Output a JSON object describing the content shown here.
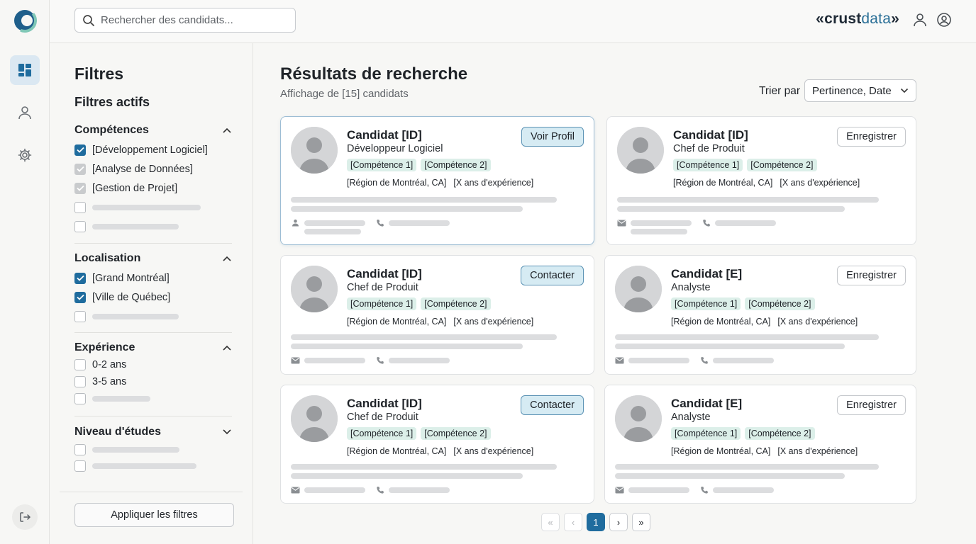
{
  "brand": {
    "prefix": "«",
    "part1": "crust",
    "part2": "data",
    "suffix": "»"
  },
  "search": {
    "placeholder": "Rechercher des candidats..."
  },
  "filters": {
    "title": "Filtres",
    "active_title": "Filtres actifs",
    "sections": [
      {
        "title": "Compétences",
        "expanded": true,
        "items": [
          {
            "label": "[Développement Logiciel]",
            "state": "checked"
          },
          {
            "label": "[Analyse de Données]",
            "state": "dim"
          },
          {
            "label": "[Gestion de Projet]",
            "state": "dim"
          }
        ]
      },
      {
        "title": "Localisation",
        "expanded": true,
        "items": [
          {
            "label": "[Grand Montréal]",
            "state": "checked"
          },
          {
            "label": "[Ville de Québec]",
            "state": "checked"
          }
        ]
      },
      {
        "title": "Expérience",
        "expanded": true,
        "items": [
          {
            "label": "0-2 ans",
            "state": "unchecked"
          },
          {
            "label": "3-5 ans",
            "state": "unchecked"
          }
        ]
      },
      {
        "title": "Niveau d'études",
        "expanded": false,
        "items": []
      }
    ],
    "apply_label": "Appliquer les filtres"
  },
  "results": {
    "title": "Résultats de recherche",
    "count": "Affichage de [15] candidats",
    "sort_label": "Trier par",
    "sort_value": "Pertinence, Date"
  },
  "cards": [
    {
      "name": "Candidat [ID]",
      "role": "Développeur Logiciel",
      "tags": [
        "[Compétence 1]",
        "[Compétence 2]"
      ],
      "region": "[Région de Montréal, CA]",
      "experience": "[X ans d'expérience]",
      "button": "Voir Profil"
    },
    {
      "name": "Candidat [ID]",
      "role": "Chef de Produit",
      "tags": [
        "[Compétence 1]",
        "[Compétence 2]"
      ],
      "region": "[Région de Montréal, CA]",
      "experience": "[X ans d'expérience]",
      "button": "Enregistrer"
    },
    {
      "name": "Candidat [ID]",
      "role": "Chef de Produit",
      "tags": [
        "[Compétence 1]",
        "[Compétence 2]"
      ],
      "region": "[Région de Montréal, CA]",
      "experience": "[X ans d'expérience]",
      "button": "Contacter"
    },
    {
      "name": "Candidat [E]",
      "role": "Analyste",
      "tags": [
        "[Compétence 1]",
        "[Compétence 2]"
      ],
      "region": "[Région de Montréal, CA]",
      "experience": "[X ans d'expérience]",
      "button": "Enregistrer"
    },
    {
      "name": "Candidat [ID]",
      "role": "Chef de Produit",
      "tags": [
        "[Compétence 1]",
        "[Compétence 2]"
      ],
      "region": "[Région de Montréal, CA]",
      "experience": "[X ans d'expérience]",
      "button": "Contacter"
    },
    {
      "name": "Candidat [E]",
      "role": "Analyste",
      "tags": [
        "[Compétence 1]",
        "[Compétence 2]"
      ],
      "region": "[Région de Montréal, CA]",
      "experience": "[X ans d'expérience]",
      "button": "Enregistrer"
    }
  ],
  "pagination": {
    "current": "1",
    "first": "«",
    "prev": "‹",
    "next": "›",
    "last": "»"
  },
  "colors": {
    "accent": "#1f6c9e",
    "tag_bg": "#dcefe9",
    "primary_btn_bg": "#d6ebf3",
    "active_nav_bg": "#dbe8f2"
  },
  "icons": {
    "rail": [
      "dashboard-icon",
      "user-icon",
      "gear-icon",
      "logout-icon"
    ],
    "top": [
      "user-icon",
      "account-circle-icon"
    ]
  }
}
